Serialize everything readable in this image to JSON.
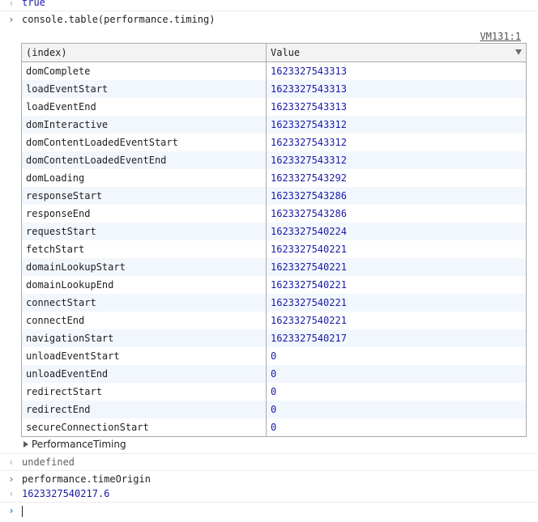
{
  "prev_result": "true",
  "command1": "console.table(performance.timing)",
  "source_link": "VM131:1",
  "table": {
    "headers": [
      "(index)",
      "Value"
    ],
    "rows": [
      {
        "index": "domComplete",
        "value": "1623327543313"
      },
      {
        "index": "loadEventStart",
        "value": "1623327543313"
      },
      {
        "index": "loadEventEnd",
        "value": "1623327543313"
      },
      {
        "index": "domInteractive",
        "value": "1623327543312"
      },
      {
        "index": "domContentLoadedEventStart",
        "value": "1623327543312"
      },
      {
        "index": "domContentLoadedEventEnd",
        "value": "1623327543312"
      },
      {
        "index": "domLoading",
        "value": "1623327543292"
      },
      {
        "index": "responseStart",
        "value": "1623327543286"
      },
      {
        "index": "responseEnd",
        "value": "1623327543286"
      },
      {
        "index": "requestStart",
        "value": "1623327540224"
      },
      {
        "index": "fetchStart",
        "value": "1623327540221"
      },
      {
        "index": "domainLookupStart",
        "value": "1623327540221"
      },
      {
        "index": "domainLookupEnd",
        "value": "1623327540221"
      },
      {
        "index": "connectStart",
        "value": "1623327540221"
      },
      {
        "index": "connectEnd",
        "value": "1623327540221"
      },
      {
        "index": "navigationStart",
        "value": "1623327540217"
      },
      {
        "index": "unloadEventStart",
        "value": "0"
      },
      {
        "index": "unloadEventEnd",
        "value": "0"
      },
      {
        "index": "redirectStart",
        "value": "0"
      },
      {
        "index": "redirectEnd",
        "value": "0"
      },
      {
        "index": "secureConnectionStart",
        "value": "0"
      }
    ]
  },
  "object_label": "PerformanceTiming",
  "result1": "undefined",
  "command2": "performance.timeOrigin",
  "result2": "1623327540217.6",
  "icons": {
    "input_prompt": "chevron-right-icon",
    "output": "return-arrow-icon",
    "expand": "triangle-right-icon",
    "sort": "triangle-down-icon"
  },
  "colors": {
    "number": "#1a1aa6",
    "prompt": "#1a73e8",
    "row_alt": "#f2f7fd"
  }
}
